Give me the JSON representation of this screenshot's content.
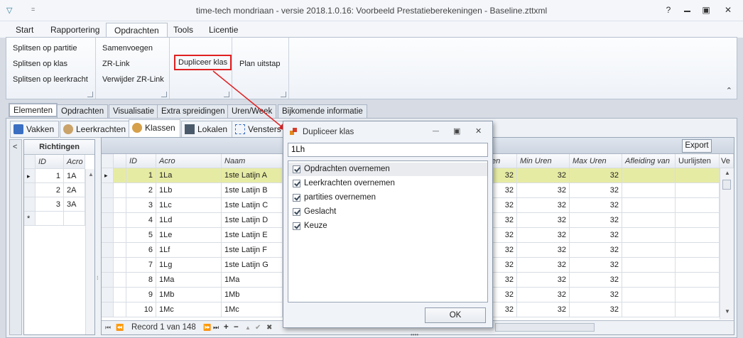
{
  "window": {
    "title": "time-tech mondriaan - versie 2018.1.0.16: Voorbeeld Prestatieberekeningen - Baseline.zttxml",
    "quick_access": "▽",
    "quick_arrow": "=",
    "help": "?",
    "restore": "▣",
    "close": "✕"
  },
  "ribbon_tabs": [
    "Start",
    "Rapportering",
    "Opdrachten",
    "Tools",
    "Licentie"
  ],
  "ribbon": {
    "group1": [
      "Splitsen op partitie",
      "Splitsen op klas",
      "Splitsen op leerkracht"
    ],
    "group2": [
      "Samenvoegen",
      "ZR-Link",
      "Verwijder ZR-Link"
    ],
    "group3": [
      "Dupliceer klas"
    ],
    "group4": [
      "Plan uitstap"
    ],
    "collapse": "⌃"
  },
  "main_tabs": [
    "Elementen",
    "Opdrachten",
    "Visualisatie",
    "Extra spreidingen",
    "Uren/Week",
    "Bijkomende informatie"
  ],
  "sub_tabs": [
    "Vakken",
    "Leerkrachten",
    "Klassen",
    "Lokalen",
    "Vensters"
  ],
  "left_panel": {
    "collapse": "<",
    "title": "Richtingen",
    "headers": [
      "ID",
      "Acro"
    ],
    "rows": [
      {
        "id": "1",
        "acro": "1A"
      },
      {
        "id": "2",
        "acro": "2A"
      },
      {
        "id": "3",
        "acro": "3A"
      }
    ],
    "new_row_marker": "*",
    "current_marker": "▸"
  },
  "main_grid": {
    "headers": [
      "ID",
      "Acro",
      "Naam",
      "en",
      "Min Uren",
      "Max Uren",
      "Afleiding van",
      "Uurlijsten",
      "Ve"
    ],
    "rows": [
      {
        "id": "1",
        "acro": "1La",
        "naam": "1ste Latijn A",
        "en": "32",
        "min": "32",
        "max": "32"
      },
      {
        "id": "2",
        "acro": "1Lb",
        "naam": "1ste Latijn B",
        "en": "32",
        "min": "32",
        "max": "32"
      },
      {
        "id": "3",
        "acro": "1Lc",
        "naam": "1ste Latijn C",
        "en": "32",
        "min": "32",
        "max": "32"
      },
      {
        "id": "4",
        "acro": "1Ld",
        "naam": "1ste Latijn D",
        "en": "32",
        "min": "32",
        "max": "32"
      },
      {
        "id": "5",
        "acro": "1Le",
        "naam": "1ste Latijn E",
        "en": "32",
        "min": "32",
        "max": "32"
      },
      {
        "id": "6",
        "acro": "1Lf",
        "naam": "1ste Latijn F",
        "en": "32",
        "min": "32",
        "max": "32"
      },
      {
        "id": "7",
        "acro": "1Lg",
        "naam": "1ste Latijn G",
        "en": "32",
        "min": "32",
        "max": "32"
      },
      {
        "id": "8",
        "acro": "1Ma",
        "naam": "1Ma",
        "en": "32",
        "min": "32",
        "max": "32"
      },
      {
        "id": "9",
        "acro": "1Mb",
        "naam": "1Mb",
        "en": "32",
        "min": "32",
        "max": "32"
      },
      {
        "id": "10",
        "acro": "1Mc",
        "naam": "1Mc",
        "en": "32",
        "min": "32",
        "max": "32"
      }
    ],
    "export_label": "Export",
    "navigator": {
      "first": "⏮",
      "prev_page": "⏪",
      "record_text": "Record 1 van 148",
      "next_page": "⏩",
      "last": "⏭",
      "add": "+",
      "remove": "−",
      "up": "▲",
      "confirm": "✔",
      "cancel": "✖"
    },
    "splitter": "••••"
  },
  "dialog": {
    "title": "Dupliceer klas",
    "input_value": "1Lh",
    "options": [
      "Opdrachten overnemen",
      "Leerkrachten overnemen",
      "partities overnemen",
      "Geslacht",
      "Keuze"
    ],
    "checked": [
      true,
      true,
      true,
      true,
      true
    ],
    "ok_label": "OK",
    "minimize": "—",
    "restore": "▣",
    "close": "✕"
  },
  "colors": {
    "accent_red": "#e02020",
    "selected_row": "#e6eba4",
    "ribbon_bg": "#eef2f8"
  }
}
